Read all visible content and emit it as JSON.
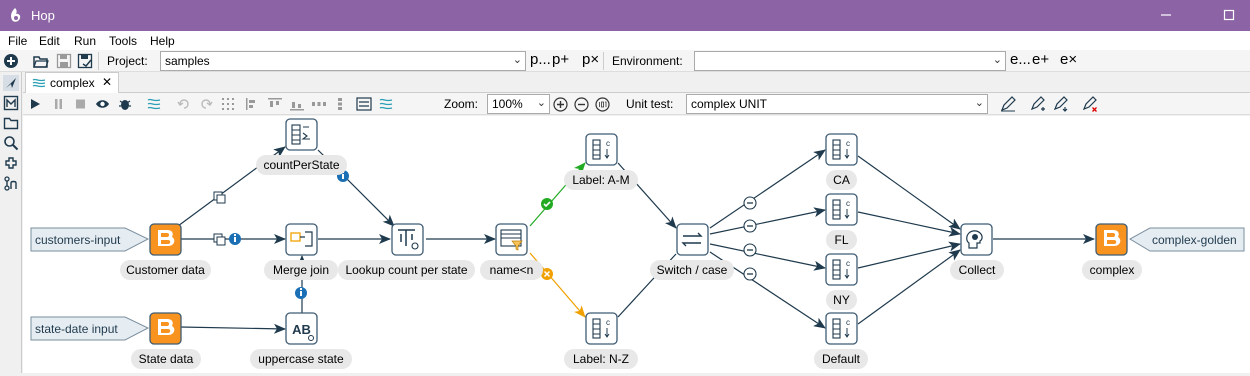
{
  "app": {
    "title": "Hop"
  },
  "menu": {
    "items": [
      "File",
      "Edit",
      "Run",
      "Tools",
      "Help"
    ]
  },
  "toolbar": {
    "project_label": "Project:",
    "project_value": "samples",
    "environment_label": "Environment:",
    "environment_value": "",
    "p_buttons": [
      "p...",
      "p+",
      "p×"
    ],
    "e_buttons": [
      "e...",
      "e+",
      "e×"
    ]
  },
  "tab": {
    "label": "complex"
  },
  "pipeline_toolbar": {
    "zoom_label": "Zoom:",
    "zoom_value": "100%",
    "unit_test_label": "Unit test:",
    "unit_test_value": "complex UNIT"
  },
  "nodes": {
    "customers_input": "customers-input",
    "state_date_input": "state-date input",
    "customer_data": "Customer data",
    "state_data": "State data",
    "count_per_state": "countPerState",
    "merge_join": "Merge join",
    "uppercase_state": "uppercase state",
    "lookup_count": "Lookup count per state",
    "name_filter": "name<n",
    "label_am": "Label: A-M",
    "label_nz": "Label: N-Z",
    "switch_case": "Switch / case",
    "ca": "CA",
    "fl": "FL",
    "ny": "NY",
    "default": "Default",
    "collect": "Collect",
    "complex": "complex",
    "complex_golden": "complex-golden"
  },
  "colors": {
    "titlebar": "#8c64a5",
    "hop_line": "#1f3a4d",
    "true_hop": "#22aa22",
    "false_hop": "#f0a000",
    "node_border": "#3f5c73",
    "dataset_fill": "#e6edf2"
  }
}
